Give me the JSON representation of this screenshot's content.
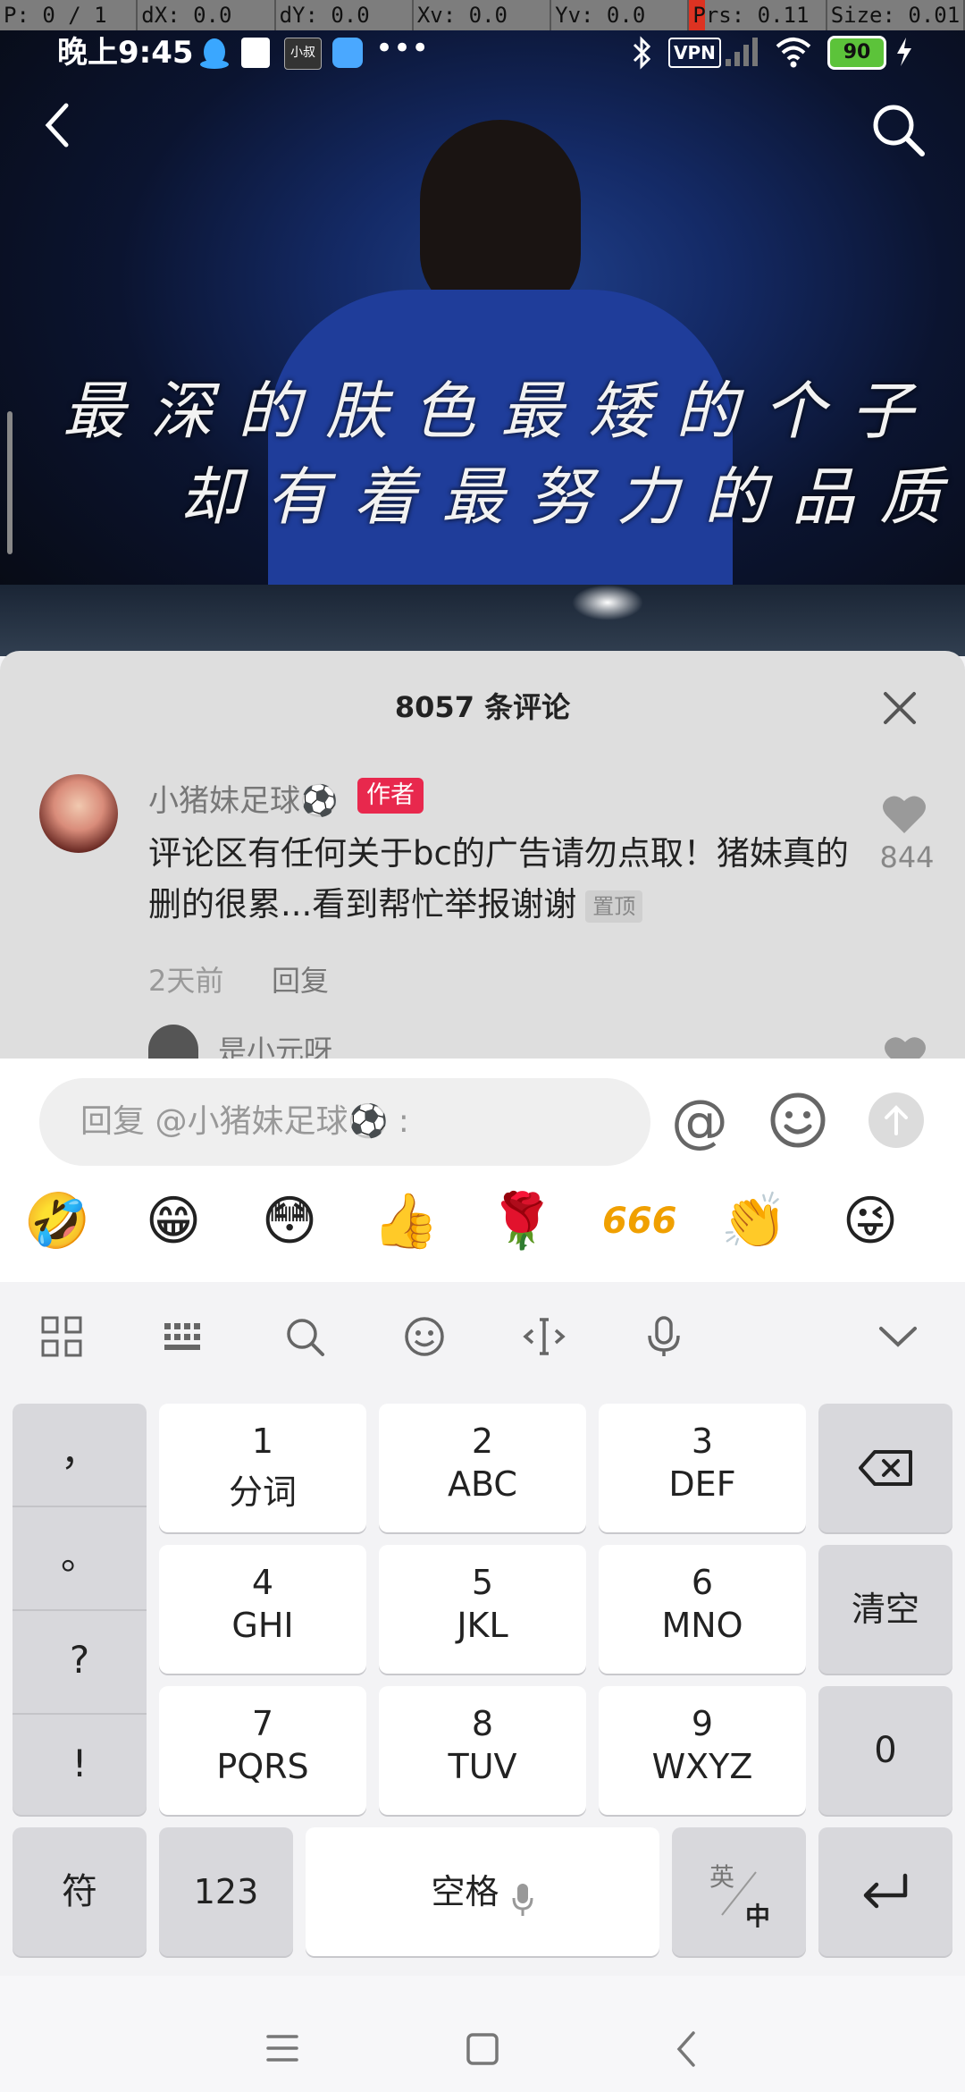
{
  "debug": {
    "fields": [
      "P: 0 / 1",
      "dX: 0.0",
      "dY: 0.0",
      "Xv: 0.0",
      "Yv: 0.0",
      "Prs: 0.11",
      "Size: 0.01"
    ]
  },
  "status_bar": {
    "time": "晚上9:45",
    "vpn": "VPN",
    "battery": "90",
    "app_icon_label": "小叔"
  },
  "video": {
    "caption_line1": "最深的肤色最矮的个子",
    "caption_line2": "却有着最努力的品质"
  },
  "comments": {
    "title": "8057 条评论",
    "items": [
      {
        "username": "小猪妹足球⚽",
        "badge": "作者",
        "text": "评论区有任何关于bc的广告请勿点取！猪妹真的删的很累...看到帮忙举报谢谢",
        "pinned": "置顶",
        "likes": "844",
        "time": "2天前",
        "reply": "回复"
      },
      {
        "username": "是小元呀"
      }
    ]
  },
  "reply": {
    "placeholder": "回复 @小猪妹足球⚽ :",
    "at": "@"
  },
  "emojis": [
    "🤣",
    "😁",
    "😳",
    "👍",
    "🌹",
    "666",
    "👏",
    "😜"
  ],
  "keyboard": {
    "punctuation": [
      "，",
      "。",
      "?",
      "!"
    ],
    "keys": [
      {
        "num": "1",
        "lbl": "分词"
      },
      {
        "num": "2",
        "lbl": "ABC"
      },
      {
        "num": "3",
        "lbl": "DEF"
      },
      {
        "num": "4",
        "lbl": "GHI"
      },
      {
        "num": "5",
        "lbl": "JKL"
      },
      {
        "num": "6",
        "lbl": "MNO"
      },
      {
        "num": "7",
        "lbl": "PQRS"
      },
      {
        "num": "8",
        "lbl": "TUV"
      },
      {
        "num": "9",
        "lbl": "WXYZ"
      }
    ],
    "clear": "清空",
    "zero": "0",
    "symbols": "符",
    "numbers": "123",
    "space": "空格",
    "lang_en": "英",
    "lang_zh": "中"
  }
}
